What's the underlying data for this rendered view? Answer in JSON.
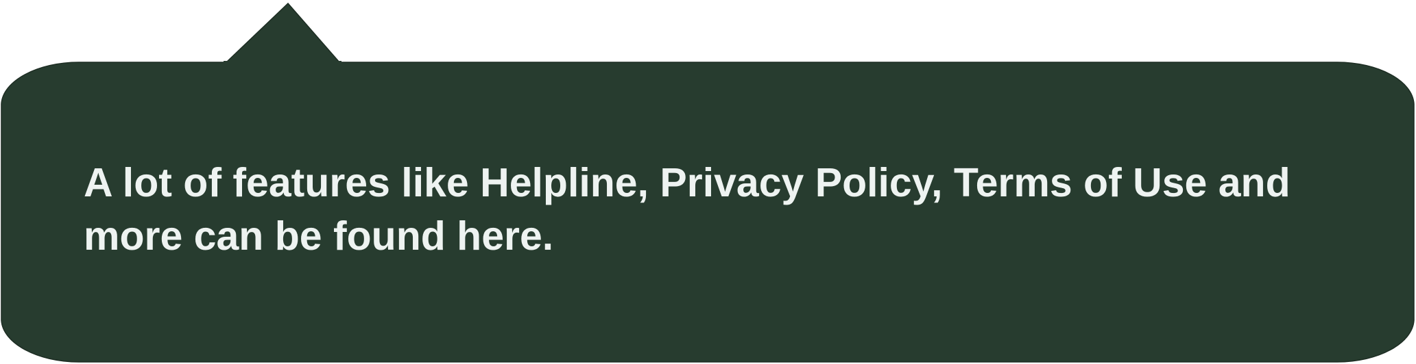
{
  "tooltip": {
    "text": "A lot of features like Helpline, Privacy Policy, Terms of Use and more can be found here.",
    "background_color": "#273c2f",
    "text_color": "#eef3f1"
  }
}
